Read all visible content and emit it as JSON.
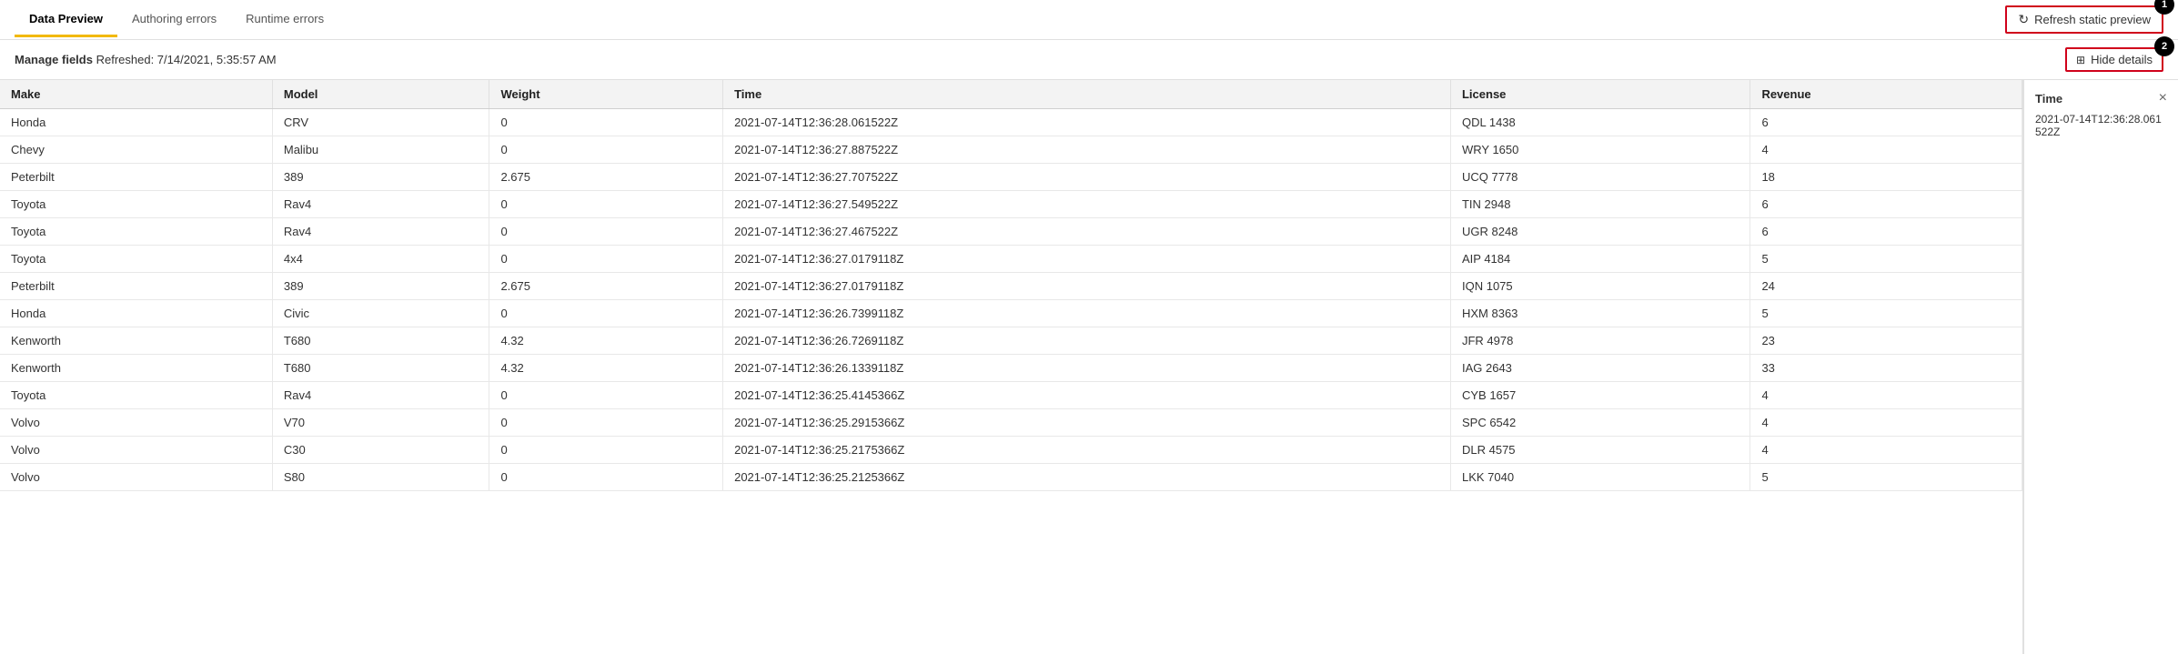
{
  "tabs": [
    {
      "id": "data-preview",
      "label": "Data Preview",
      "active": true
    },
    {
      "id": "authoring-errors",
      "label": "Authoring errors",
      "active": false
    },
    {
      "id": "runtime-errors",
      "label": "Runtime errors",
      "active": false
    }
  ],
  "refresh_button": {
    "label": "Refresh static preview",
    "icon": "refresh-icon",
    "badge": "1"
  },
  "sub_header": {
    "manage_label": "Manage fields",
    "refreshed_text": "Refreshed: 7/14/2021, 5:35:57 AM"
  },
  "hide_details_button": {
    "label": "Hide details",
    "icon": "hide-icon",
    "badge": "2"
  },
  "table": {
    "columns": [
      "Make",
      "Model",
      "Weight",
      "Time",
      "License",
      "Revenue"
    ],
    "rows": [
      [
        "Honda",
        "CRV",
        "0",
        "2021-07-14T12:36:28.061522Z",
        "QDL 1438",
        "6"
      ],
      [
        "Chevy",
        "Malibu",
        "0",
        "2021-07-14T12:36:27.887522Z",
        "WRY 1650",
        "4"
      ],
      [
        "Peterbilt",
        "389",
        "2.675",
        "2021-07-14T12:36:27.707522Z",
        "UCQ 7778",
        "18"
      ],
      [
        "Toyota",
        "Rav4",
        "0",
        "2021-07-14T12:36:27.549522Z",
        "TIN 2948",
        "6"
      ],
      [
        "Toyota",
        "Rav4",
        "0",
        "2021-07-14T12:36:27.467522Z",
        "UGR 8248",
        "6"
      ],
      [
        "Toyota",
        "4x4",
        "0",
        "2021-07-14T12:36:27.0179118Z",
        "AIP 4184",
        "5"
      ],
      [
        "Peterbilt",
        "389",
        "2.675",
        "2021-07-14T12:36:27.0179118Z",
        "IQN 1075",
        "24"
      ],
      [
        "Honda",
        "Civic",
        "0",
        "2021-07-14T12:36:26.7399118Z",
        "HXM 8363",
        "5"
      ],
      [
        "Kenworth",
        "T680",
        "4.32",
        "2021-07-14T12:36:26.7269118Z",
        "JFR 4978",
        "23"
      ],
      [
        "Kenworth",
        "T680",
        "4.32",
        "2021-07-14T12:36:26.1339118Z",
        "IAG 2643",
        "33"
      ],
      [
        "Toyota",
        "Rav4",
        "0",
        "2021-07-14T12:36:25.4145366Z",
        "CYB 1657",
        "4"
      ],
      [
        "Volvo",
        "V70",
        "0",
        "2021-07-14T12:36:25.2915366Z",
        "SPC 6542",
        "4"
      ],
      [
        "Volvo",
        "C30",
        "0",
        "2021-07-14T12:36:25.2175366Z",
        "DLR 4575",
        "4"
      ],
      [
        "Volvo",
        "S80",
        "0",
        "2021-07-14T12:36:25.2125366Z",
        "LKK 7040",
        "5"
      ]
    ]
  },
  "side_panel": {
    "title": "Time",
    "close_label": "×",
    "value": "2021-07-14T12:36:28.061522Z"
  }
}
